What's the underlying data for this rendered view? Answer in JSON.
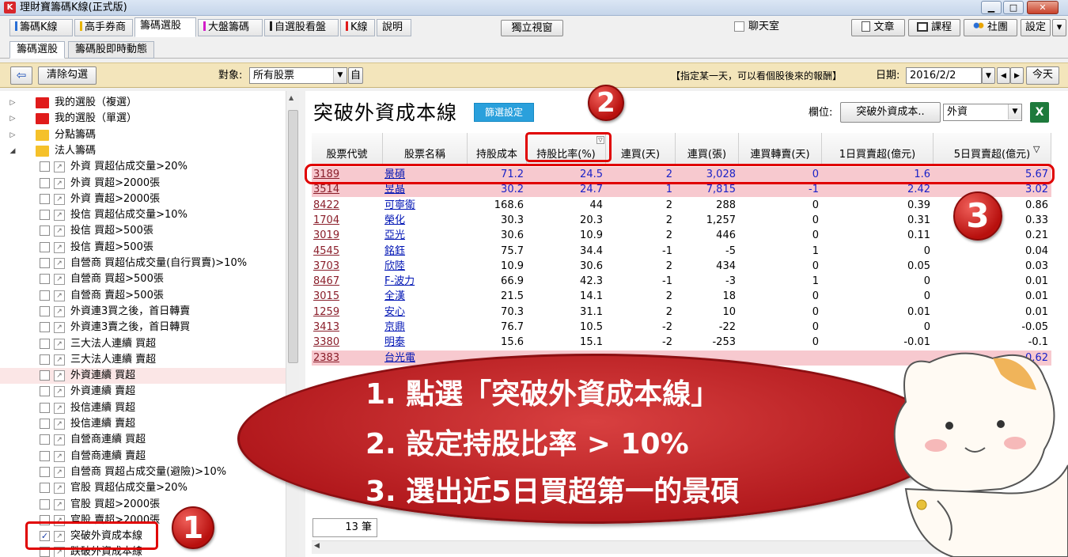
{
  "window": {
    "title": "理財寶籌碼K線(正式版)",
    "app_icon": "K",
    "min_glyph": "▁",
    "max_glyph": "□",
    "close_glyph": "✕"
  },
  "main_tabs": [
    {
      "label": "籌碼K線",
      "color": "#2a6fd6"
    },
    {
      "label": "高手券商",
      "color": "#e8b400"
    },
    {
      "label": "籌碼選股",
      "color": ""
    },
    {
      "label": "大盤籌碼",
      "color": "#d21cc8"
    },
    {
      "label": "自選股看盤",
      "color": "#222222"
    },
    {
      "label": "K線",
      "color": "#e01b1b"
    },
    {
      "label": "說明",
      "color": ""
    }
  ],
  "header": {
    "independent_view": "獨立視窗",
    "chatroom_label": "聊天室",
    "article": "文章",
    "course": "課程",
    "community": "社團",
    "settings": "設定",
    "dropdown_glyph": "▾"
  },
  "sub_tabs": [
    "籌碼選股",
    "籌碼股即時動態"
  ],
  "toolbar": {
    "back_glyph": "⇦",
    "clear": "清除勾選",
    "target_label": "對象:",
    "target_value": "所有股票",
    "self_button": "自",
    "hint": "【指定某一天，可以看個股後來的報酬】",
    "date_label": "日期:",
    "date_value": "2016/2/2",
    "today": "今天"
  },
  "tree": [
    {
      "type": "folder",
      "color": "red",
      "label": "我的選股（複選）",
      "twist": "▷"
    },
    {
      "type": "folder",
      "color": "red",
      "label": "我的選股（單選）",
      "twist": "▷"
    },
    {
      "type": "folder",
      "color": "yel",
      "label": "分點籌碼",
      "twist": "▷"
    },
    {
      "type": "folder",
      "color": "yel",
      "label": "法人籌碼",
      "twist": "◢"
    },
    {
      "type": "item",
      "label": "外資 買超佔成交量>20%"
    },
    {
      "type": "item",
      "label": "外資 買超>2000張"
    },
    {
      "type": "item",
      "label": "外資 賣超>2000張"
    },
    {
      "type": "item",
      "label": "投信 買超佔成交量>10%"
    },
    {
      "type": "item",
      "label": "投信 買超>500張"
    },
    {
      "type": "item",
      "label": "投信 賣超>500張"
    },
    {
      "type": "item",
      "label": "自營商 買超佔成交量(自行買賣)>10%"
    },
    {
      "type": "item",
      "label": "自營商 買超>500張"
    },
    {
      "type": "item",
      "label": "自營商 賣超>500張"
    },
    {
      "type": "item",
      "label": "外資連3買之後，首日轉賣"
    },
    {
      "type": "item",
      "label": "外資連3賣之後，首日轉買"
    },
    {
      "type": "item",
      "label": "三大法人連續 買超"
    },
    {
      "type": "item",
      "label": "三大法人連續 賣超"
    },
    {
      "type": "item",
      "label": "外資連續 買超",
      "highlight": true
    },
    {
      "type": "item",
      "label": "外資連續 賣超"
    },
    {
      "type": "item",
      "label": "投信連續 買超"
    },
    {
      "type": "item",
      "label": "投信連續 賣超"
    },
    {
      "type": "item",
      "label": "自營商連續 買超"
    },
    {
      "type": "item",
      "label": "自營商連續 賣超"
    },
    {
      "type": "item",
      "label": "自營商 買超占成交量(避險)>10%"
    },
    {
      "type": "item",
      "label": "官股 買超佔成交量>20%"
    },
    {
      "type": "item",
      "label": "官股 買超>2000張"
    },
    {
      "type": "item",
      "label": "官股 賣超>2000張"
    },
    {
      "type": "item",
      "label": "突破外資成本線",
      "checked": true
    },
    {
      "type": "item",
      "label": "跌破外資成本線"
    }
  ],
  "panel": {
    "title": "突破外資成本線",
    "filter_button": "篩選設定",
    "column_label": "欄位:",
    "column_button": "突破外資成本..",
    "column_select": "外資",
    "excel_icon": "X",
    "count": "13 筆"
  },
  "grid": {
    "headers": [
      "股票代號",
      "股票名稱",
      "持股成本",
      "持股比率(%)",
      "連買(天)",
      "連買(張)",
      "連買轉賣(天)",
      "1日買賣超(億元)",
      "5日買賣超(億元)"
    ],
    "rows": [
      {
        "code": "3189",
        "name": "景碩",
        "cost": "71.2",
        "ratio": "24.5",
        "days": "2",
        "lots": "3,028",
        "rev": "0",
        "d1": "1.6",
        "d5": "5.67",
        "pink": true
      },
      {
        "code": "3514",
        "name": "昱晶",
        "cost": "30.2",
        "ratio": "24.7",
        "days": "1",
        "lots": "7,815",
        "rev": "-1",
        "d1": "2.42",
        "d5": "3.02",
        "pink": true
      },
      {
        "code": "8422",
        "name": "可寧衛",
        "cost": "168.6",
        "ratio": "44",
        "days": "2",
        "lots": "288",
        "rev": "0",
        "d1": "0.39",
        "d5": "0.86"
      },
      {
        "code": "1704",
        "name": "榮化",
        "cost": "30.3",
        "ratio": "20.3",
        "days": "2",
        "lots": "1,257",
        "rev": "0",
        "d1": "0.31",
        "d5": "0.33"
      },
      {
        "code": "3019",
        "name": "亞光",
        "cost": "30.6",
        "ratio": "10.9",
        "days": "2",
        "lots": "446",
        "rev": "0",
        "d1": "0.11",
        "d5": "0.21"
      },
      {
        "code": "4545",
        "name": "銘鈺",
        "cost": "75.7",
        "ratio": "34.4",
        "days": "-1",
        "lots": "-5",
        "rev": "1",
        "d1": "0",
        "d5": "0.04"
      },
      {
        "code": "3703",
        "name": "欣陸",
        "cost": "10.9",
        "ratio": "30.6",
        "days": "2",
        "lots": "434",
        "rev": "0",
        "d1": "0.05",
        "d5": "0.03"
      },
      {
        "code": "8467",
        "name": "F-波力",
        "cost": "66.9",
        "ratio": "42.3",
        "days": "-1",
        "lots": "-3",
        "rev": "1",
        "d1": "0",
        "d5": "0.01"
      },
      {
        "code": "3015",
        "name": "全漢",
        "cost": "21.5",
        "ratio": "14.1",
        "days": "2",
        "lots": "18",
        "rev": "0",
        "d1": "0",
        "d5": "0.01"
      },
      {
        "code": "1259",
        "name": "安心",
        "cost": "70.3",
        "ratio": "31.1",
        "days": "2",
        "lots": "10",
        "rev": "0",
        "d1": "0.01",
        "d5": "0.01"
      },
      {
        "code": "3413",
        "name": "京鼎",
        "cost": "76.7",
        "ratio": "10.5",
        "days": "-2",
        "lots": "-22",
        "rev": "0",
        "d1": "0",
        "d5": "-0.05"
      },
      {
        "code": "3380",
        "name": "明泰",
        "cost": "15.6",
        "ratio": "15.1",
        "days": "-2",
        "lots": "-253",
        "rev": "0",
        "d1": "-0.01",
        "d5": "-0.1"
      },
      {
        "code": "2383",
        "name": "台光電",
        "cost": "",
        "ratio": "",
        "days": "",
        "lots": "",
        "rev": "",
        "d1": "",
        "d5": "-0.62",
        "pink": true
      }
    ]
  },
  "annotations": {
    "badge1": "1",
    "badge2": "2",
    "badge3": "3",
    "lines": [
      "1. 點選「突破外資成本線」",
      "2. 設定持股比率 > 10%",
      "3. 選出近5日買超第一的景碩"
    ],
    "accent": "#e00000"
  }
}
